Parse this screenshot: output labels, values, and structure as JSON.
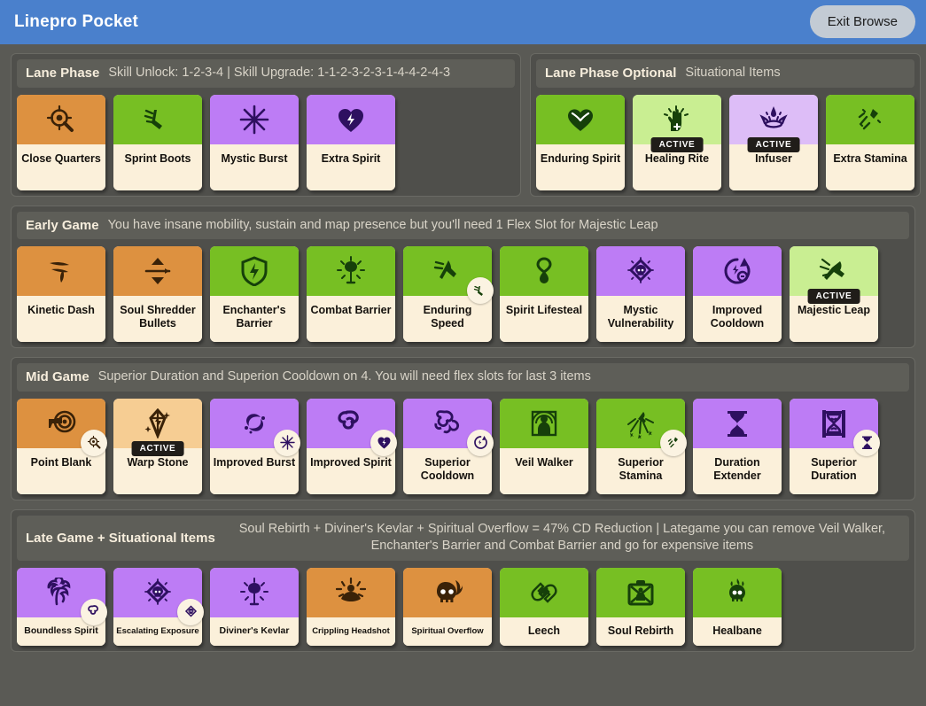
{
  "titlebar": {
    "app_title": "Linepro Pocket",
    "exit_label": "Exit Browse"
  },
  "colors": {
    "titlebar": "#4a80cc",
    "page_bg": "#5a5a55",
    "section_bg": "#4f4f4b",
    "header_bg": "#5e5e58",
    "card_label_bg": "#fbf0da",
    "orange": "#dd9140",
    "orange_light": "#f6cd93",
    "green": "#77bf23",
    "green_light": "#c9ee92",
    "purple": "#bd7cf5",
    "purple_light": "#ddbdf7",
    "active_badge_bg": "#201d19"
  },
  "sections": [
    {
      "id": "lane-phase",
      "title": "Lane Phase",
      "note": "Skill Unlock: 1-2-3-4 | Skill Upgrade: 1-1-2-3-2-3-1-4-4-2-4-3",
      "note_lines": 1,
      "cards": [
        {
          "name": "Close Quarters",
          "color": "orange",
          "icon": "scope-magnifier-icon",
          "active": false,
          "component": null
        },
        {
          "name": "Sprint Boots",
          "color": "green",
          "icon": "winged-boot-icon",
          "active": false,
          "component": null
        },
        {
          "name": "Mystic Burst",
          "color": "purple",
          "icon": "starburst-icon",
          "active": false,
          "component": null
        },
        {
          "name": "Extra Spirit",
          "color": "purple",
          "icon": "heart-spark-icon",
          "active": false,
          "component": null
        }
      ]
    },
    {
      "id": "lane-phase-optional",
      "title": "Lane Phase Optional",
      "note": "Situational Items",
      "note_lines": 1,
      "cards": [
        {
          "name": "Enduring Spirit",
          "color": "green",
          "icon": "heart-wings-icon",
          "active": false,
          "component": null
        },
        {
          "name": "Healing Rite",
          "color": "green-light",
          "icon": "healing-hand-icon",
          "active": true,
          "component": null
        },
        {
          "name": "Infuser",
          "color": "purple-light",
          "icon": "infuser-crown-icon",
          "active": true,
          "component": null
        },
        {
          "name": "Extra Stamina",
          "color": "green",
          "icon": "dash-stamina-icon",
          "active": false,
          "component": null
        }
      ]
    },
    {
      "id": "early-game",
      "title": "Early Game",
      "note": "You have insane mobility, sustain and map presence but you'll need 1 Flex Slot for Majestic Leap",
      "note_lines": 1,
      "cards": [
        {
          "name": "Kinetic Dash",
          "color": "orange",
          "icon": "kinetic-dash-icon",
          "active": false,
          "component": null
        },
        {
          "name": "Soul Shredder Bullets",
          "color": "orange",
          "icon": "arrow-updown-icon",
          "active": false,
          "component": null
        },
        {
          "name": "Enchanter's Barrier",
          "color": "green",
          "icon": "shield-bolt-icon",
          "active": false,
          "component": null
        },
        {
          "name": "Combat Barrier",
          "color": "green",
          "icon": "radiant-shield-icon",
          "active": false,
          "component": null
        },
        {
          "name": "Enduring Speed",
          "color": "green",
          "icon": "winged-leg-icon",
          "active": false,
          "component": "sprint-boots-icon"
        },
        {
          "name": "Spirit Lifesteal",
          "color": "green",
          "icon": "heart-drop-icon",
          "active": false,
          "component": null
        },
        {
          "name": "Mystic Vulnerability",
          "color": "purple",
          "icon": "skull-diamond-icon",
          "active": false,
          "component": null
        },
        {
          "name": "Improved Cooldown",
          "color": "purple",
          "icon": "cooldown-cycle-icon",
          "active": false,
          "component": null
        },
        {
          "name": "Majestic Leap",
          "color": "green-light",
          "icon": "leap-icon",
          "active": true,
          "component": null
        }
      ]
    },
    {
      "id": "mid-game",
      "title": "Mid Game",
      "note": "Superior Duration and Superion Cooldown on 4. You will need flex slots for last 3 items",
      "note_lines": 1,
      "cards": [
        {
          "name": "Point Blank",
          "color": "orange",
          "icon": "pistol-target-icon",
          "active": false,
          "component": "close-quarters-icon"
        },
        {
          "name": "Warp Stone",
          "color": "orange-light",
          "icon": "crystal-icon",
          "active": true,
          "component": null
        },
        {
          "name": "Improved Burst",
          "color": "purple",
          "icon": "burst-splash-icon",
          "active": false,
          "component": "mystic-burst-icon"
        },
        {
          "name": "Improved Spirit",
          "color": "purple",
          "icon": "triple-swirl-icon",
          "active": false,
          "component": "extra-spirit-icon"
        },
        {
          "name": "Superior Cooldown",
          "color": "purple",
          "icon": "superior-swirl-icon",
          "active": false,
          "component": "improved-cooldown-icon"
        },
        {
          "name": "Veil Walker",
          "color": "green",
          "icon": "veil-figure-icon",
          "active": false,
          "component": null
        },
        {
          "name": "Superior Stamina",
          "color": "green",
          "icon": "stamina-burst-icon",
          "active": false,
          "component": "extra-stamina-icon"
        },
        {
          "name": "Duration Extender",
          "color": "purple",
          "icon": "hourglass-icon",
          "active": false,
          "component": null
        },
        {
          "name": "Superior Duration",
          "color": "purple",
          "icon": "ornate-hourglass-icon",
          "active": false,
          "component": "duration-extender-icon"
        }
      ]
    },
    {
      "id": "late-game",
      "title": "Late Game + Situational Items",
      "note": "Soul Rebirth + Diviner's Kevlar + Spiritual Overflow = 47% CD Reduction | Lategame you can remove Veil Walker, Enchanter's Barrier and Combat Barrier and go for expensive items",
      "note_lines": 2,
      "cards": [
        {
          "name": "Boundless Spirit",
          "color": "purple",
          "icon": "boundless-bloom-icon",
          "active": false,
          "component": "improved-spirit-icon"
        },
        {
          "name": "Escalating Exposure",
          "color": "purple",
          "icon": "skull-diamond-icon",
          "active": false,
          "component": "mystic-vulnerability-icon"
        },
        {
          "name": "Diviner's Kevlar",
          "color": "purple",
          "icon": "radiant-shield-icon",
          "active": false,
          "component": null
        },
        {
          "name": "Crippling Headshot",
          "color": "orange",
          "icon": "meditate-icon",
          "active": false,
          "component": null
        },
        {
          "name": "Spiritual Overflow",
          "color": "orange",
          "icon": "flaming-skull-icon",
          "active": false,
          "component": null
        },
        {
          "name": "Leech",
          "color": "green",
          "icon": "hands-heart-icon",
          "active": false,
          "component": null
        },
        {
          "name": "Soul Rebirth",
          "color": "green",
          "icon": "rebirth-case-icon",
          "active": false,
          "component": null
        },
        {
          "name": "Healbane",
          "color": "green",
          "icon": "burning-skull-icon",
          "active": false,
          "component": null
        }
      ]
    }
  ]
}
